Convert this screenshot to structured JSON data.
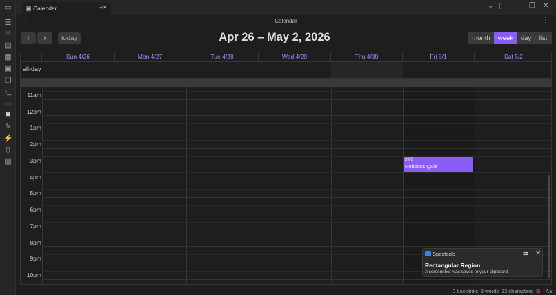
{
  "tab": {
    "title": "Calendar"
  },
  "view_header": {
    "title": "Calendar"
  },
  "toolbar": {
    "prev": "‹",
    "next": "›",
    "today_label": "today"
  },
  "range_title": "Apr 26 – May 2, 2026",
  "view_buttons": [
    {
      "label": "month",
      "active": false
    },
    {
      "label": "week",
      "active": true
    },
    {
      "label": "day",
      "active": false
    },
    {
      "label": "list",
      "active": false
    }
  ],
  "calendar": {
    "day_headers": [
      "Sun 4/26",
      "Mon 4/27",
      "Tue 4/28",
      "Wed 4/29",
      "Thu 4/30",
      "Fri 5/1",
      "Sat 5/2"
    ],
    "allday_label": "all-day",
    "hours": [
      "11am",
      "12pm",
      "1pm",
      "2pm",
      "3pm",
      "4pm",
      "5pm",
      "6pm",
      "7pm",
      "8pm",
      "9pm",
      "10pm"
    ],
    "events": [
      {
        "day": "Fri 5/1",
        "time": "3:00",
        "title": "Robotics Quiz",
        "color": "#8b5cf6"
      }
    ]
  },
  "notification": {
    "app": "Spectacle",
    "title": "Rectangular Region",
    "body": "A screenshot was saved to your clipboard."
  },
  "status": {
    "backlinks": "0 backlinks",
    "words": "5 words",
    "characters": "33 characters",
    "aa": "Aa"
  },
  "colors": {
    "accent": "#8b5cf6",
    "header_text": "#a78bfa",
    "background": "#1e1e1e"
  },
  "icons": {
    "ribbon": [
      "sidebar-toggle-icon",
      "files-icon",
      "graph-icon",
      "page-icon",
      "grid-icon",
      "calendar-icon",
      "copy-icon",
      "terminal-icon",
      "git-icon",
      "tools-icon",
      "brush-icon",
      "plugin-icon",
      "clipboard-icon",
      "calendar-small-icon"
    ]
  }
}
